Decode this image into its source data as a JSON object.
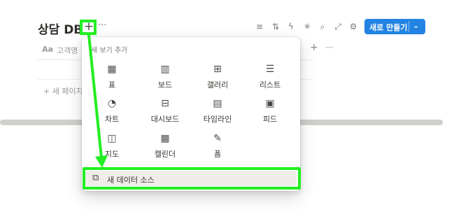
{
  "header": {
    "title": "상담 DB",
    "add_view": "+",
    "more": "···",
    "new_button": {
      "label": "새로 만들기",
      "chevron": "⌄"
    },
    "tools": [
      "filter-icon",
      "sort-icon",
      "automation-icon",
      "loading-icon",
      "search-icon",
      "expand-icon",
      "settings-icon"
    ]
  },
  "table": {
    "title_col_icon": "Aa",
    "title_col_name": "고객명",
    "add_col": "+",
    "more_col": "···",
    "new_page": "+  새 페이지"
  },
  "popover": {
    "title": "새 보기 추가",
    "options": [
      {
        "label": "표",
        "icon": "▦"
      },
      {
        "label": "보드",
        "icon": "▥"
      },
      {
        "label": "갤러리",
        "icon": "⊞"
      },
      {
        "label": "리스트",
        "icon": "☰"
      },
      {
        "label": "차트",
        "icon": "◔"
      },
      {
        "label": "대시보드",
        "icon": "⊟"
      },
      {
        "label": "타임라인",
        "icon": "▤"
      },
      {
        "label": "피드",
        "icon": "▣"
      },
      {
        "label": "지도",
        "icon": "◫"
      },
      {
        "label": "캘린더",
        "icon": "▦"
      },
      {
        "label": "폼",
        "icon": "✎"
      }
    ],
    "new_source": {
      "label": "새 데이터 소스",
      "icon": "⧉"
    }
  },
  "annotation": {
    "color": "#22ee22"
  }
}
